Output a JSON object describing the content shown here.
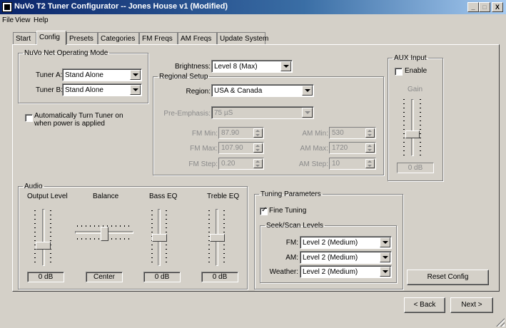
{
  "window": {
    "title": "NuVo T2 Tuner Configurator -- Jones House v1 (Modified)",
    "minimize": "_",
    "maximize": "□",
    "close": "X"
  },
  "menu": [
    "File",
    "View",
    "Help"
  ],
  "tabs": [
    "Start",
    "Config",
    "Presets",
    "Categories",
    "FM Freqs",
    "AM Freqs",
    "Update System"
  ],
  "active_tab": "Config",
  "net_mode": {
    "legend": "NuVo Net Operating Mode",
    "tuner_a_label": "Tuner A:",
    "tuner_a_value": "Stand Alone",
    "tuner_b_label": "Tuner B:",
    "tuner_b_value": "Stand Alone"
  },
  "auto_on": {
    "label_line1": "Automatically Turn Tuner on",
    "label_line2": "when power is applied",
    "checked": false
  },
  "brightness": {
    "label": "Brightness:",
    "value": "Level 8 (Max)"
  },
  "regional": {
    "legend": "Regional Setup",
    "region_label": "Region:",
    "region_value": "USA & Canada",
    "pre_emphasis_label": "Pre-Emphasis:",
    "pre_emphasis_value": "75 µS",
    "fm_min_label": "FM Min:",
    "fm_min_value": "87.90",
    "fm_max_label": "FM Max:",
    "fm_max_value": "107.90",
    "fm_step_label": "FM Step:",
    "fm_step_value": "0.20",
    "am_min_label": "AM Min:",
    "am_min_value": "530",
    "am_max_label": "AM Max:",
    "am_max_value": "1720",
    "am_step_label": "AM Step:",
    "am_step_value": "10"
  },
  "aux": {
    "legend": "AUX Input",
    "enable_label": "Enable",
    "enabled": false,
    "gain_label": "Gain",
    "gain_value": "0 dB"
  },
  "audio": {
    "legend": "Audio",
    "output_label": "Output Level",
    "output_value": "0 dB",
    "balance_label": "Balance",
    "balance_value": "Center",
    "bass_label": "Bass EQ",
    "bass_value": "0 dB",
    "treble_label": "Treble EQ",
    "treble_value": "0 dB"
  },
  "tuning": {
    "legend": "Tuning Parameters",
    "fine_label": "Fine Tuning",
    "fine_checked": true,
    "seek_legend": "Seek/Scan Levels",
    "fm_label": "FM:",
    "fm_value": "Level 2 (Medium)",
    "am_label": "AM:",
    "am_value": "Level 2 (Medium)",
    "weather_label": "Weather:",
    "weather_value": "Level 2 (Medium)"
  },
  "buttons": {
    "reset": "Reset Config",
    "back": "< Back",
    "next": "Next >"
  }
}
